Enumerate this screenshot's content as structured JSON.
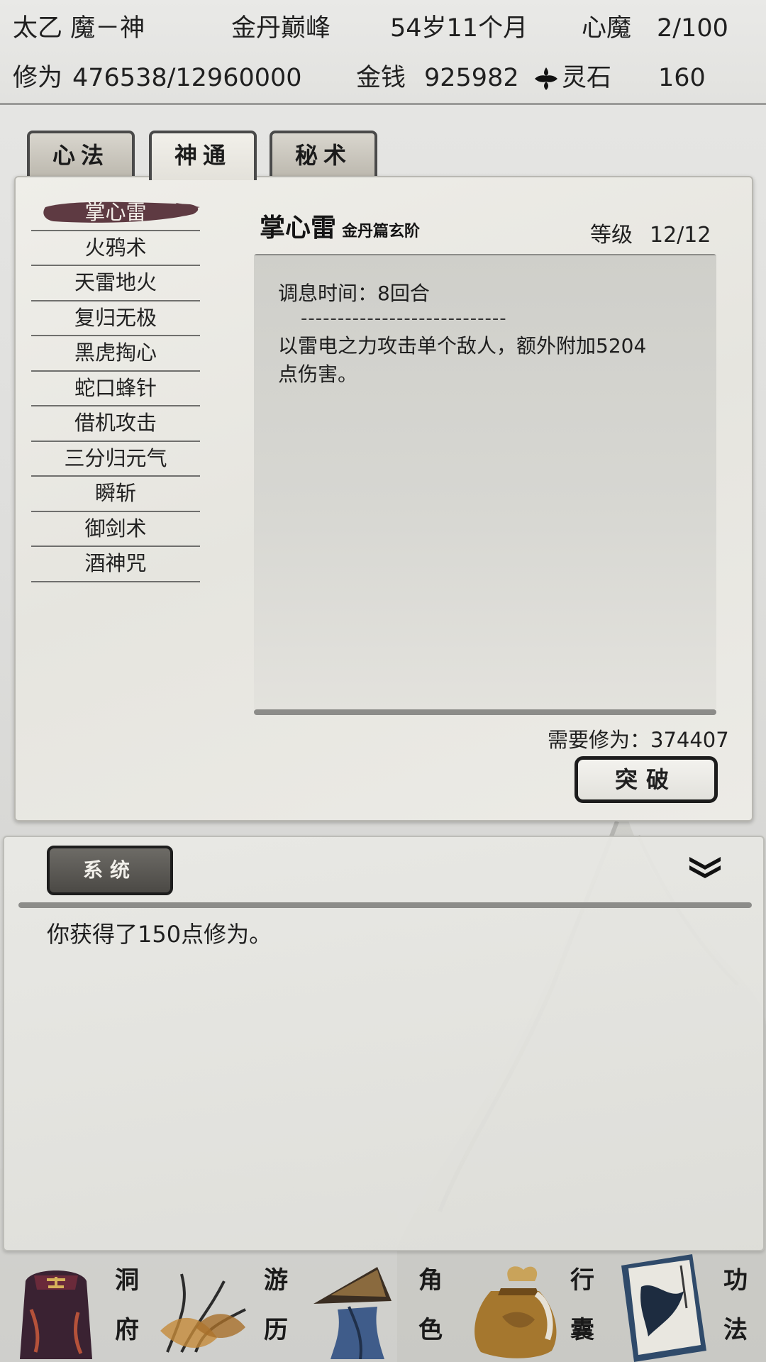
{
  "status": {
    "name": "太乙 魔－神",
    "realm": "金丹巅峰",
    "age": "54岁11个月",
    "demon_label": "心魔",
    "demon_value": "2/100",
    "cultivation_label": "修为",
    "cultivation_value": "476538/12960000",
    "money_label": "金钱",
    "money_value": "925982",
    "spirit_stone_label": "灵石",
    "spirit_stone_value": "160"
  },
  "tabs": [
    {
      "label": "心法",
      "active": false
    },
    {
      "label": "神通",
      "active": true
    },
    {
      "label": "秘术",
      "active": false
    }
  ],
  "skills": [
    {
      "name": "掌心雷",
      "selected": true
    },
    {
      "name": "火鸦术"
    },
    {
      "name": "天雷地火"
    },
    {
      "name": "复归无极"
    },
    {
      "name": "黑虎掏心"
    },
    {
      "name": "蛇口蜂针"
    },
    {
      "name": "借机攻击"
    },
    {
      "name": "三分归元气"
    },
    {
      "name": "瞬斩"
    },
    {
      "name": "御剑术"
    },
    {
      "name": "酒神咒"
    }
  ],
  "detail": {
    "title": "掌心雷",
    "subtitle": "金丹篇玄阶",
    "level_label": "等级",
    "level_value": "12/12",
    "cooldown": "调息时间：8回合",
    "divider": "----------------------------",
    "description_line1": "以雷电之力攻击单个敌人，额外附加5204",
    "description_line2": "点伤害。",
    "requirement": "需要修为：374407",
    "breakthrough_label": "突破"
  },
  "log": {
    "tab_label": "系统",
    "messages": [
      "你获得了150点修为。"
    ]
  },
  "nav": [
    {
      "label_top": "洞",
      "label_bottom": "府",
      "icon": "cave-residence-icon"
    },
    {
      "label_top": "游",
      "label_bottom": "历",
      "icon": "travel-icon"
    },
    {
      "label_top": "角",
      "label_bottom": "色",
      "icon": "character-icon"
    },
    {
      "label_top": "行",
      "label_bottom": "囊",
      "icon": "inventory-bag-icon"
    },
    {
      "label_top": "功",
      "label_bottom": "法",
      "icon": "technique-book-icon"
    }
  ],
  "colors": {
    "selected_brush": "#5e3a42",
    "ink": "#1a1a1a",
    "parchment": "#ecebe6"
  }
}
